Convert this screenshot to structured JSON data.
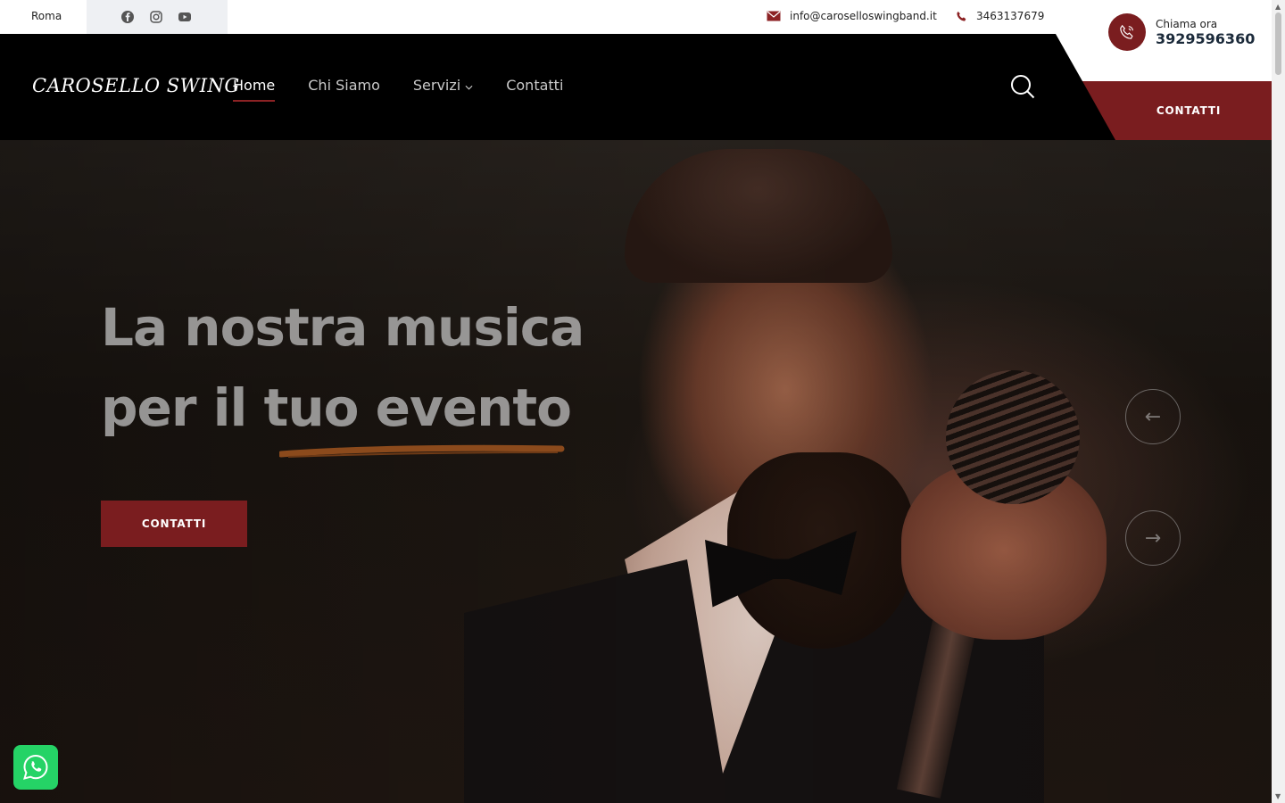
{
  "topbar": {
    "city": "Roma",
    "social": [
      "facebook-icon",
      "instagram-icon",
      "youtube-icon"
    ],
    "email": "info@caroselloswingband.it",
    "phone": "3463137679"
  },
  "navbar": {
    "logo": "CAROSELLO SWING",
    "items": [
      {
        "label": "Home",
        "active": true
      },
      {
        "label": "Chi Siamo",
        "active": false
      },
      {
        "label": "Servizi",
        "active": false,
        "has_dropdown": true
      },
      {
        "label": "Contatti",
        "active": false
      }
    ],
    "call_label": "Chiama ora",
    "call_number": "3929596360",
    "cta_label": "CONTATTI"
  },
  "hero": {
    "title_line1": "La nostra musica",
    "title_line2": "per il tuo evento",
    "button_label": "CONTATTI",
    "prev_arrow": "←",
    "next_arrow": "→"
  },
  "colors": {
    "accent": "#7a1d1f",
    "underline": "#8b4a1c",
    "whatsapp": "#25d366"
  }
}
